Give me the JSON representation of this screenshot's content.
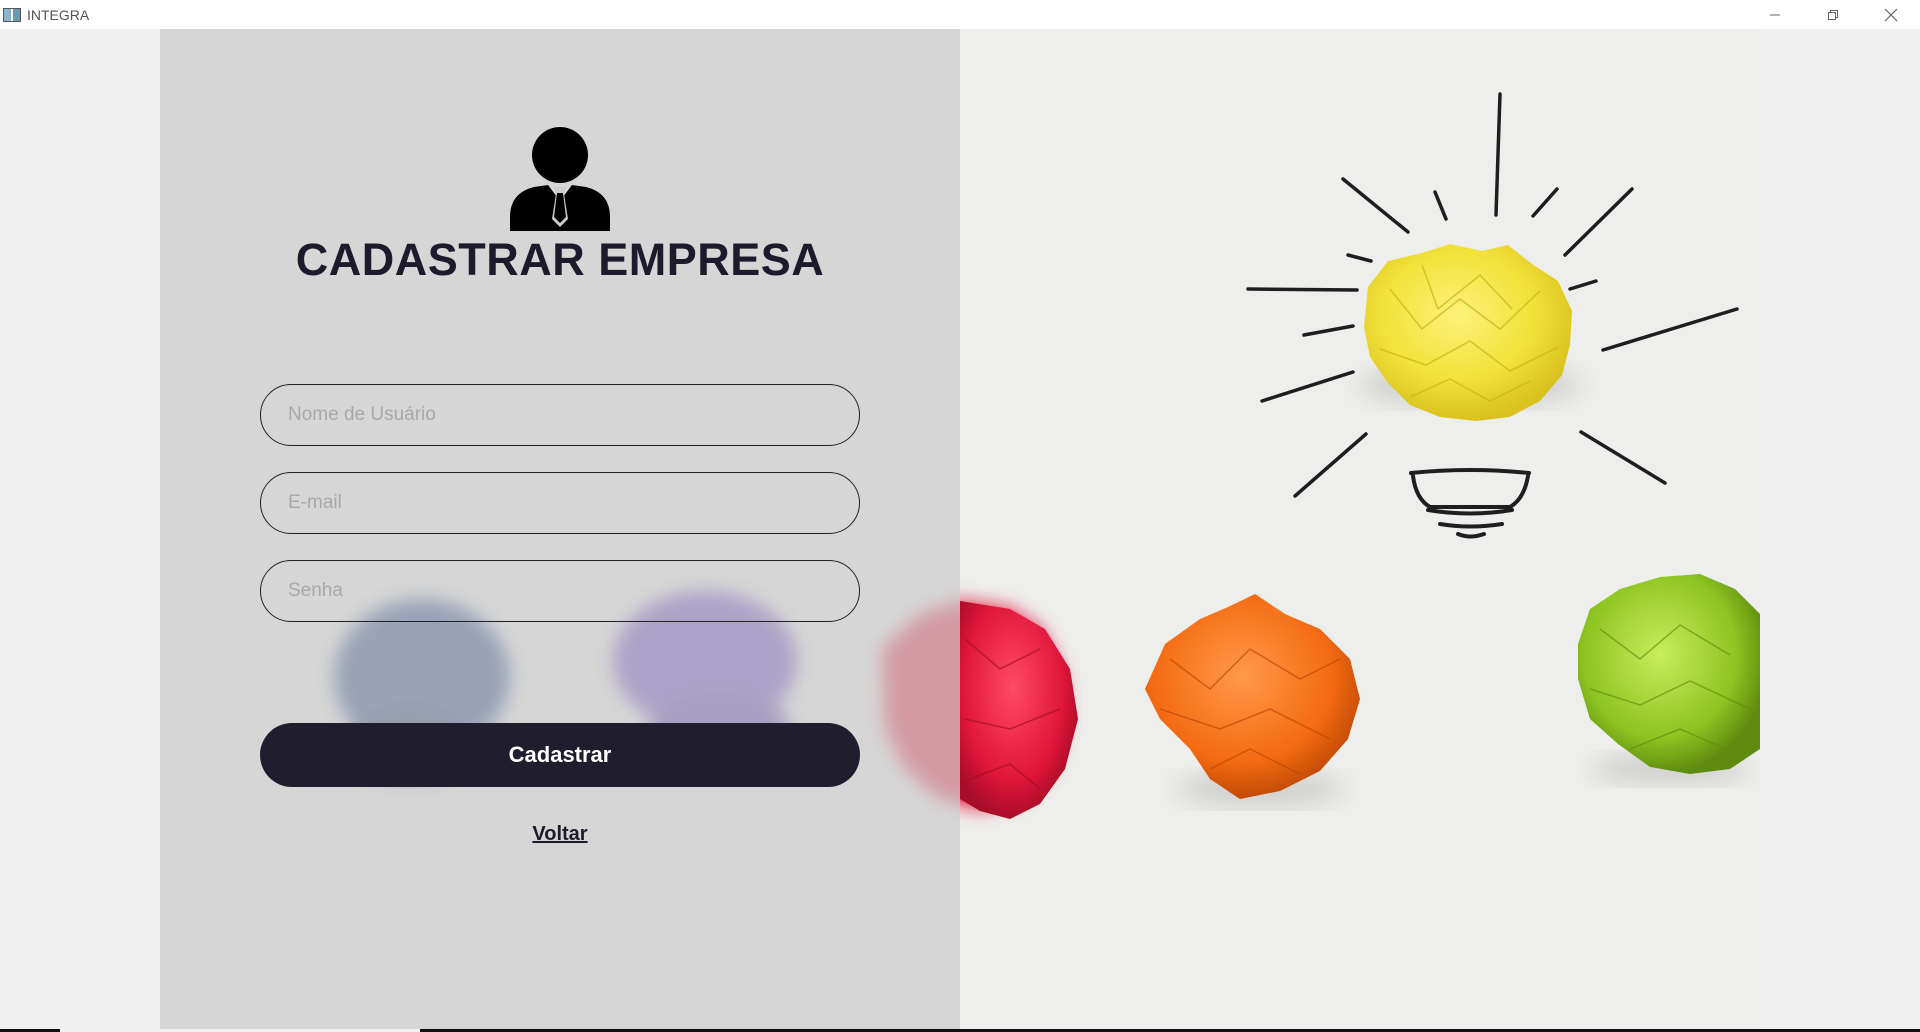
{
  "window": {
    "title": "INTEGRA",
    "minimize_icon": "minimize-icon",
    "restore_icon": "restore-icon",
    "close_icon": "close-icon"
  },
  "form": {
    "user_icon": "user-businessman-icon",
    "title": "CADASTRAR EMPRESA",
    "username_placeholder": "Nome de Usuário",
    "email_placeholder": "E-mail",
    "password_placeholder": "Senha",
    "submit_label": "Cadastrar",
    "back_label": "Voltar"
  },
  "colors": {
    "dark": "#201e2d",
    "overlay": "#cdcdcd",
    "background": "#eeeeec",
    "bulb_yellow": "#f2e23a",
    "paper_red": "#e0163a",
    "paper_orange": "#f46a12",
    "paper_green": "#8cc420",
    "paper_blue": "#1a3f8c",
    "paper_purple": "#5a35b8"
  }
}
